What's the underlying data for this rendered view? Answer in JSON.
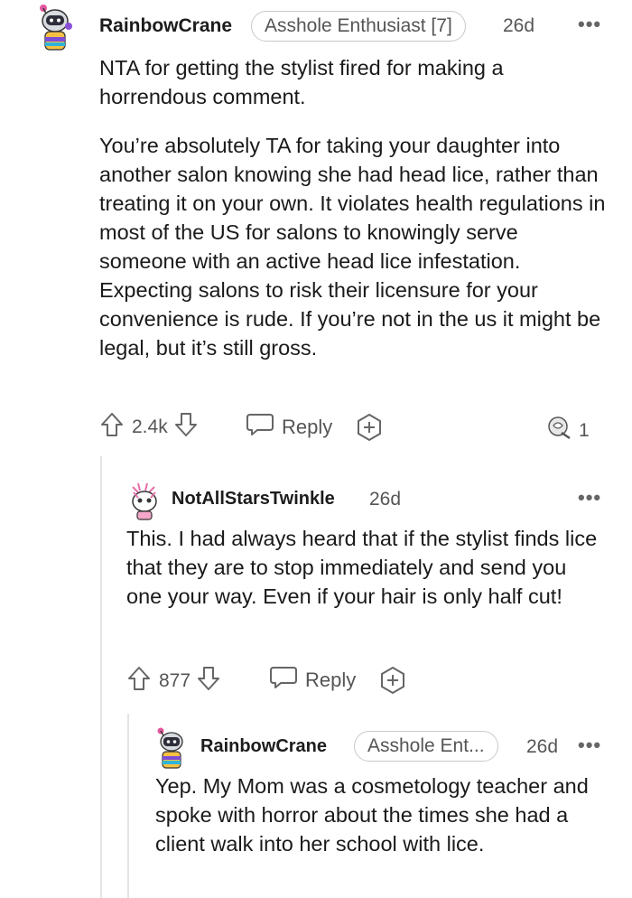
{
  "comments": [
    {
      "username": "RainbowCrane",
      "flair": "Asshole Enthusiast [7]",
      "time": "26d",
      "more": "•••",
      "paragraphs": [
        "NTA for getting the stylist fired for making a horrendous comment.",
        "You’re absolutely TA for taking your daughter into another salon knowing she had head lice, rather than treating it on your own. It violates health regulations in most of the US for salons to knowingly serve someone with an active head lice infestation. Expecting salons to risk their licensure for your convenience is rude. If you’re not in the us it might be legal, but it’s still gross."
      ],
      "votes": "2.4k",
      "reply_label": "Reply",
      "award_count": "1"
    },
    {
      "username": "NotAllStarsTwinkle",
      "time": "26d",
      "more": "•••",
      "paragraphs": [
        "This. I had always heard that if the stylist finds lice that they are to stop immediately and send you one your way. Even if your hair is only half cut!"
      ],
      "votes": "877",
      "reply_label": "Reply"
    },
    {
      "username": "RainbowCrane",
      "flair": "Asshole Ent...",
      "time": "26d",
      "more": "•••",
      "paragraphs": [
        "Yep. My Mom was a cosmetology teacher and spoke with horror about the times she had a client walk into her school with lice."
      ]
    }
  ],
  "icons": {
    "upvote": "arrow-up-icon",
    "downvote": "arrow-down-icon",
    "reply": "speech-bubble-icon",
    "award": "plus-circle-icon",
    "award_given": "award-icon"
  }
}
